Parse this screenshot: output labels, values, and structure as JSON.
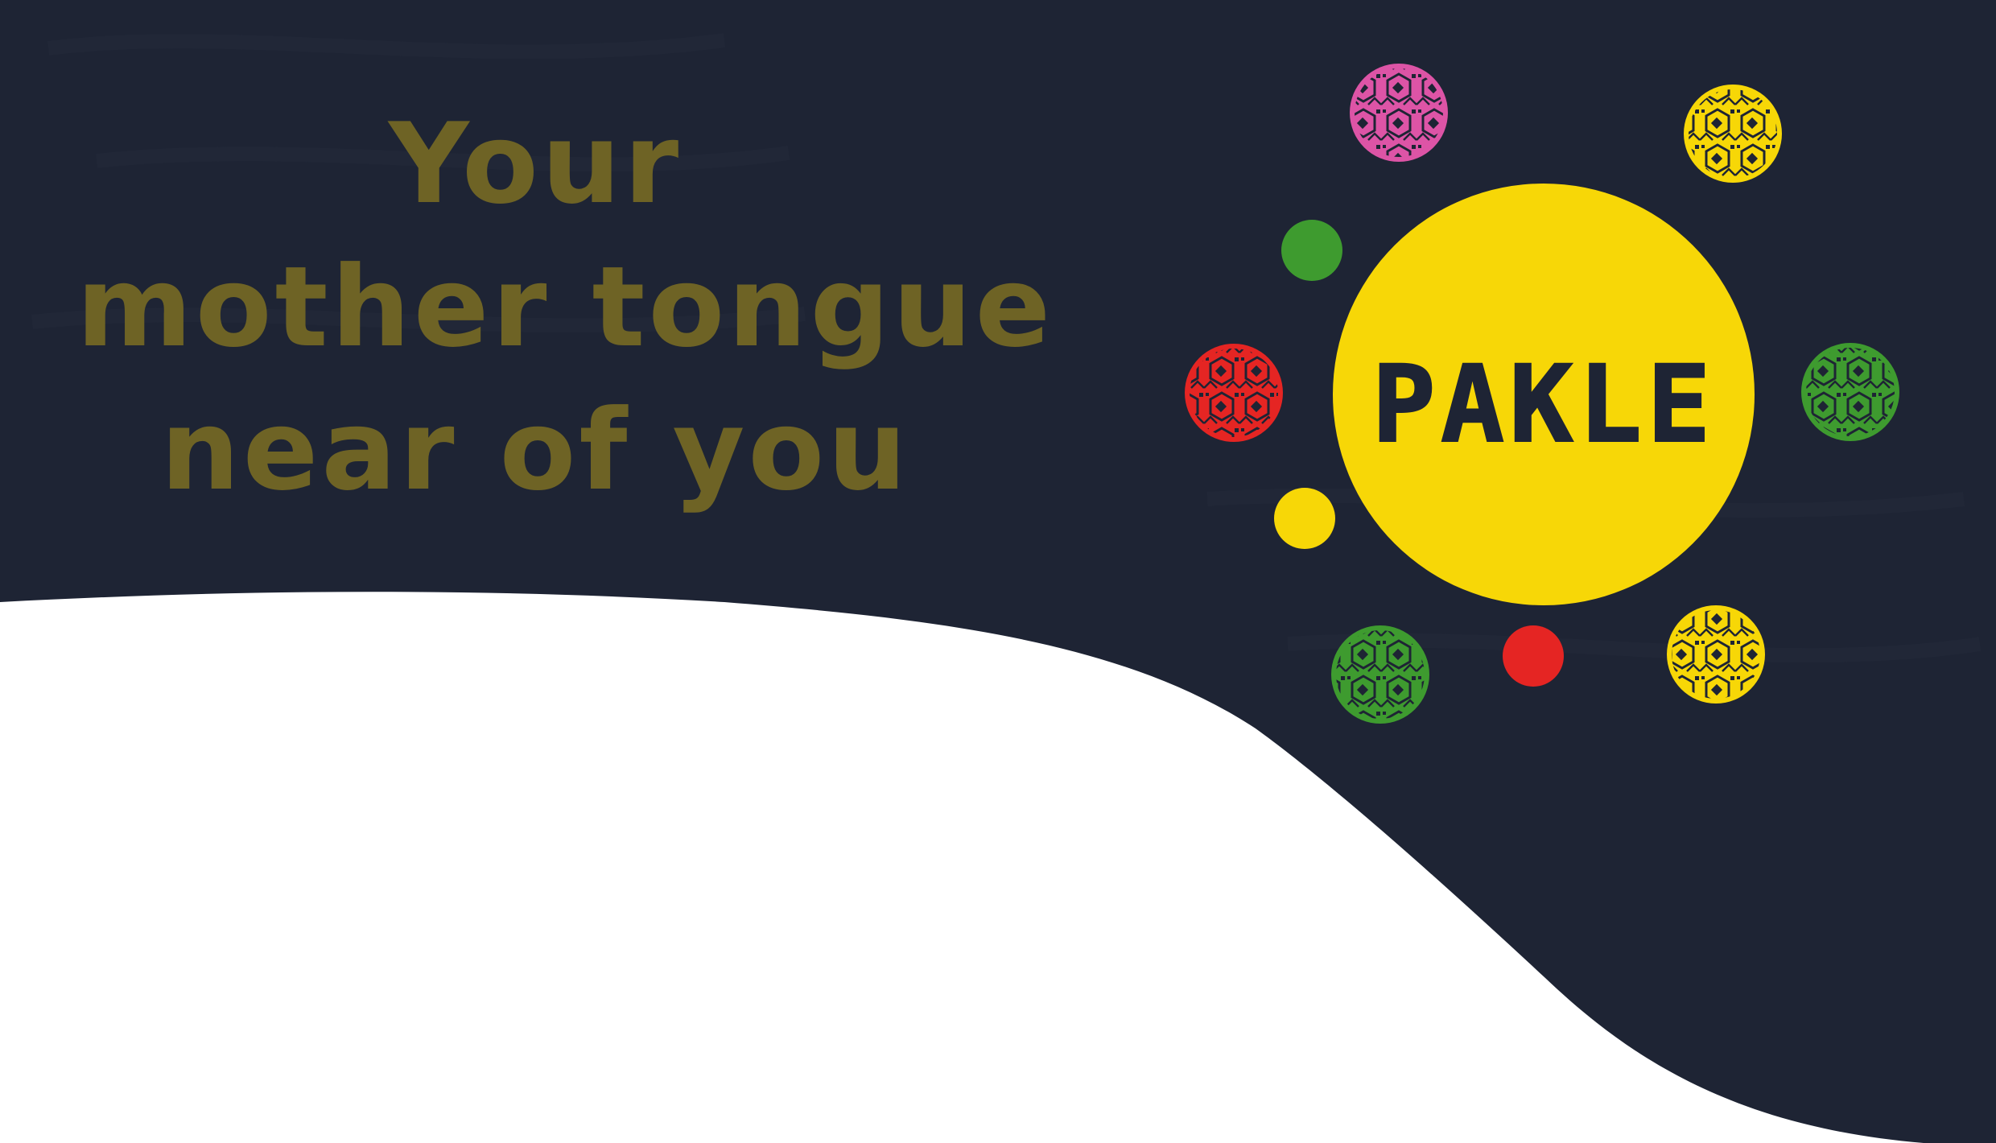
{
  "hero": {
    "tagline": [
      "Your",
      "mother tongue",
      "near of you"
    ],
    "tagline_color": "#6e6325"
  },
  "logo": {
    "wordmark": "PAKLE"
  },
  "colors": {
    "background_dark": "#1e2434",
    "background_light": "#ffffff",
    "yellow": "#f7d707",
    "green": "#3e9b2f",
    "red": "#e52523",
    "magenta": "#dd54a6"
  },
  "decorations": [
    {
      "name": "magenta-pattern-dot",
      "color": "magenta",
      "pattern": true
    },
    {
      "name": "yellow-pattern-dot",
      "color": "yellow",
      "pattern": true
    },
    {
      "name": "green-solid-dot",
      "color": "green",
      "pattern": false
    },
    {
      "name": "red-pattern-dot",
      "color": "red",
      "pattern": true
    },
    {
      "name": "green-pattern-dot",
      "color": "green",
      "pattern": true
    },
    {
      "name": "yellow-solid-dot",
      "color": "yellow",
      "pattern": false
    },
    {
      "name": "green-pattern-dot",
      "color": "green",
      "pattern": true
    },
    {
      "name": "red-solid-dot",
      "color": "red",
      "pattern": false
    },
    {
      "name": "yellow-pattern-dot",
      "color": "yellow",
      "pattern": true
    }
  ]
}
